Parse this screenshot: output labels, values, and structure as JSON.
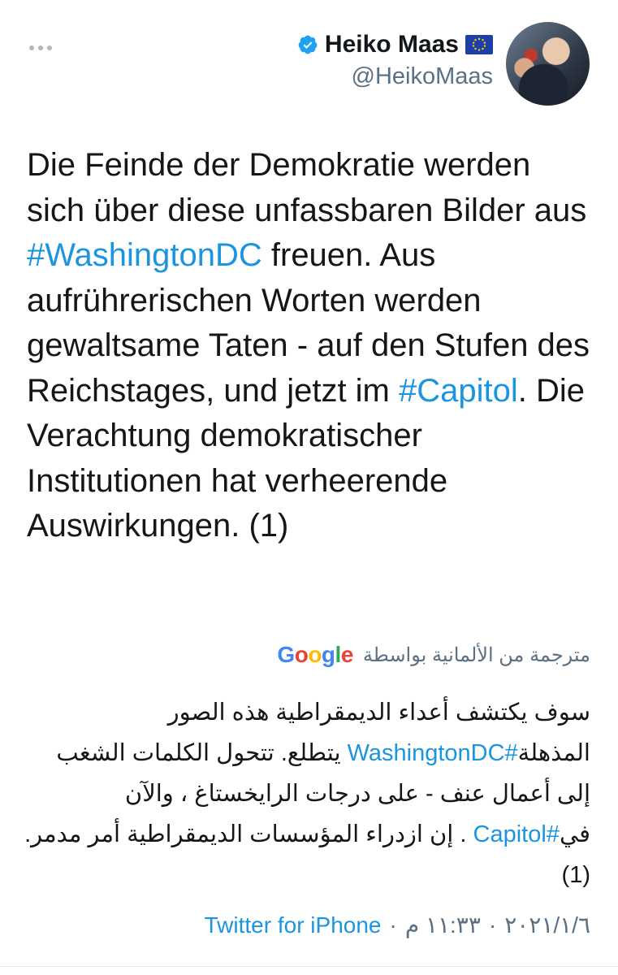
{
  "author": {
    "name": "Heiko Maas",
    "handle": "@HeikoMaas"
  },
  "tweet": {
    "part1": "Die Feinde der Demokratie werden sich über diese unfassbaren Bilder aus ",
    "hashtag1": "#WashingtonDC",
    "part2": " freuen. Aus aufrührerischen Worten werden gewaltsame Taten - auf den Stufen des Reichstages, und jetzt im ",
    "hashtag2": "#Capitol",
    "part3": ". Die Verachtung demokratischer Institutionen hat verheerende Auswirkungen. (1)"
  },
  "translation": {
    "label": "مترجمة من الألمانية بواسطة",
    "provider": "Google",
    "part1": "سوف يكتشف أعداء الديمقراطية هذه الصور المذهلة",
    "hashtag1": "#WashingtonDC",
    "part2": " يتطلع. تتحول الكلمات الشغب إلى أعمال عنف - على درجات الرايخستاغ ، والآن في",
    "hashtag2": "#Capitol",
    "part3": " . إن ازدراء المؤسسات الديمقراطية أمر مدمر. (1)"
  },
  "meta": {
    "date": "٢٠٢١/١/٦",
    "separator": "·",
    "time": "١١:٣٣ م",
    "source": "Twitter for iPhone"
  },
  "colors": {
    "link": "#1b95e0",
    "secondary_text": "#5b7083",
    "verified_badge": "#1da1f2"
  },
  "icons": {
    "more": "more-dots-icon",
    "verified": "verified-badge-icon",
    "flag": "eu-flag-icon"
  }
}
